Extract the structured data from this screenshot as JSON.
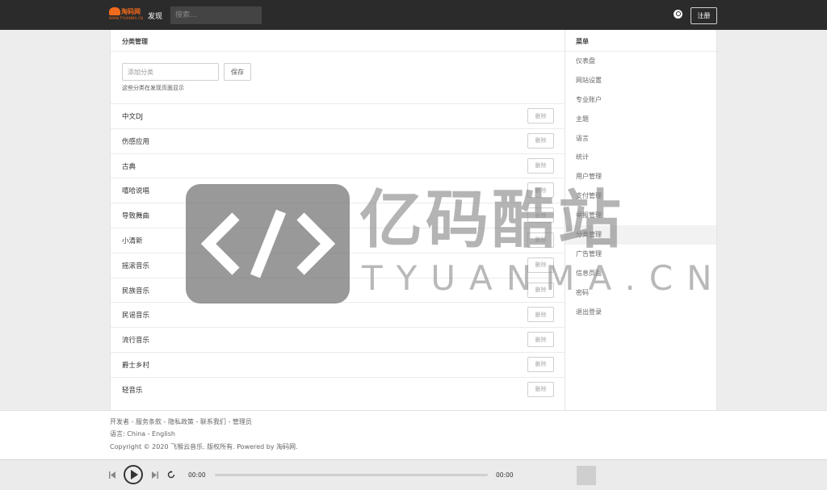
{
  "header": {
    "logo_text": "淘码网",
    "logo_sub": "WWW.TYUANMA.CN",
    "nav_discover": "发现",
    "search_placeholder": "搜索...",
    "register_label": "注册"
  },
  "main": {
    "title": "分类管理",
    "add_placeholder": "添加分类",
    "save_label": "保存",
    "hint": "这些分类在发现页面显示",
    "delete_label": "删除",
    "categories": [
      "中文DJ",
      "伤感应用",
      "古典",
      "嘻哈说唱",
      "导致舞曲",
      "小清新",
      "摇滚音乐",
      "民族音乐",
      "民谣音乐",
      "流行音乐",
      "爵士乡村",
      "轻音乐"
    ]
  },
  "sidebar": {
    "title": "菜单",
    "items": [
      "仪表盘",
      "网站设置",
      "专业账户",
      "主题",
      "语言",
      "统计",
      "用户管理",
      "支付管理",
      "举报管理",
      "分类管理",
      "广告管理",
      "信息页面",
      "密码",
      "退出登录"
    ],
    "active_index": 9
  },
  "watermark": {
    "cn": "亿码酷站",
    "en": "TYUANMA.CN"
  },
  "footer": {
    "links_line": "开发者 - 服务条款 - 隐私政策 - 联系我们 - 管理员",
    "language_line": "语言: China - English",
    "copyright": "Copyright © 2020 飞猴云音乐. 版权所有. Powered by 淘码网."
  },
  "player": {
    "current_time": "00:00",
    "total_time": "00:00",
    "progress": 0
  },
  "colors": {
    "brand": "#f26a1b",
    "topbar": "#2b2b2b"
  }
}
